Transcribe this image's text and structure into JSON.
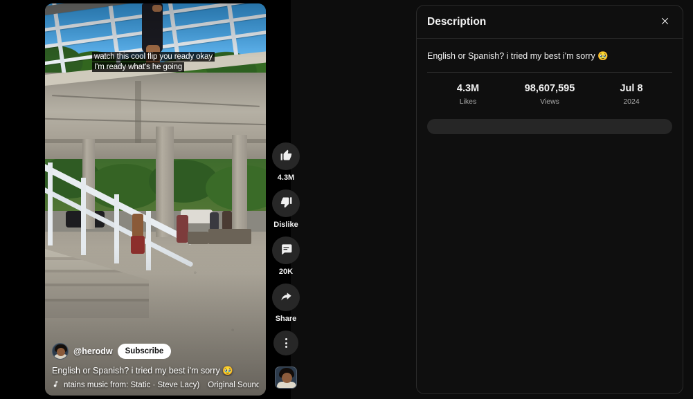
{
  "theme": {
    "page_background": "#000000",
    "panel_background": "#0f0f0f",
    "panel_border": "#2a2a2a",
    "text_primary": "#f1f1f1",
    "text_secondary": "#aaaaaa",
    "button_background": "#272727",
    "subscribe_background": "#ffffff",
    "placeholder_bar": "#262626"
  },
  "player": {
    "caption_overlay": "watch this cool flip you ready okay I'm ready what's he going",
    "channel": {
      "handle": "@herodw",
      "avatar_icon": "channel-avatar-photo",
      "subscribe_label": "Subscribe"
    },
    "video_title": "English or Spanish? i tried my best i'm sorry 🥹",
    "sound": {
      "music_icon": "music-note-icon",
      "marquee_text": "ntains music from: Static · Steve Lacy)",
      "sound_name": "Original Sound"
    },
    "actions": [
      {
        "name": "like",
        "icon": "thumbs-up-icon",
        "label": "4.3M"
      },
      {
        "name": "dislike",
        "icon": "thumbs-down-icon",
        "label": "Dislike"
      },
      {
        "name": "comments",
        "icon": "comment-bubble-icon",
        "label": "20K"
      },
      {
        "name": "share",
        "icon": "share-arrow-icon",
        "label": "Share"
      },
      {
        "name": "more",
        "icon": "more-vertical-icon",
        "label": ""
      }
    ],
    "channel_thumbnail_icon": "channel-thumbnail-photo"
  },
  "description_panel": {
    "title": "Description",
    "close_icon": "close-icon",
    "text": "English or Spanish? i tried my best i'm sorry 🥹",
    "stats": [
      {
        "value": "4.3M",
        "label": "Likes"
      },
      {
        "value": "98,607,595",
        "label": "Views"
      },
      {
        "value": "Jul 8",
        "label": "2024"
      }
    ]
  }
}
